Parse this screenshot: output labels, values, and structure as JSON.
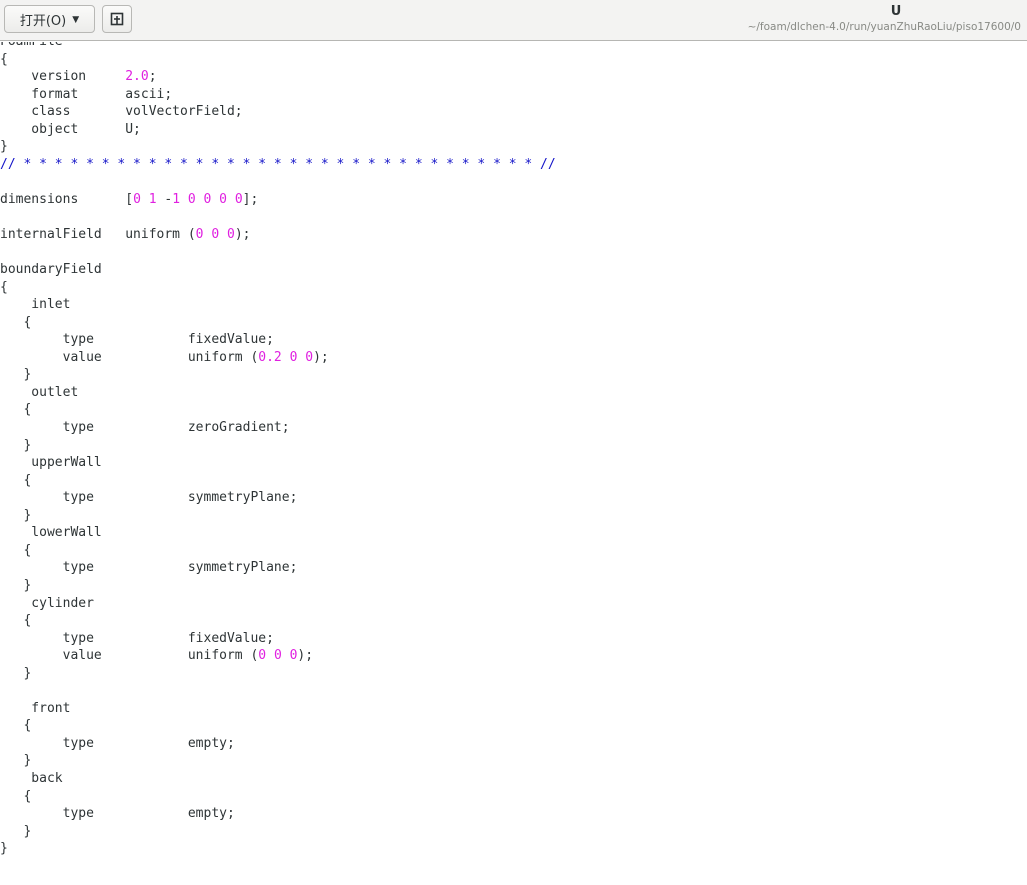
{
  "header": {
    "open_label": "打开(O)",
    "open_caret": "▼",
    "new_tab_icon": "new-tab-icon",
    "title": "U",
    "path": "~/foam/dlchen-4.0/run/yuanZhuRaoLiu/piso17600/0"
  },
  "editor": {
    "lines": [
      [
        {
          "t": "FoamFile"
        }
      ],
      [
        {
          "t": "{"
        }
      ],
      [
        {
          "t": "    version     "
        },
        {
          "t": "2.0",
          "c": "num"
        },
        {
          "t": ";"
        }
      ],
      [
        {
          "t": "    format      ascii;"
        }
      ],
      [
        {
          "t": "    class       volVectorField;"
        }
      ],
      [
        {
          "t": "    object      U;"
        }
      ],
      [
        {
          "t": "}"
        }
      ],
      [
        {
          "t": "// * * * * * * * * * * * * * * * * * * * * * * * * * * * * * * * * * //",
          "c": "comment"
        }
      ],
      [
        {
          "t": ""
        }
      ],
      [
        {
          "t": "dimensions      ["
        },
        {
          "t": "0",
          "c": "num"
        },
        {
          "t": " "
        },
        {
          "t": "1",
          "c": "num"
        },
        {
          "t": " -"
        },
        {
          "t": "1",
          "c": "num"
        },
        {
          "t": " "
        },
        {
          "t": "0",
          "c": "num"
        },
        {
          "t": " "
        },
        {
          "t": "0",
          "c": "num"
        },
        {
          "t": " "
        },
        {
          "t": "0",
          "c": "num"
        },
        {
          "t": " "
        },
        {
          "t": "0",
          "c": "num"
        },
        {
          "t": "];"
        }
      ],
      [
        {
          "t": ""
        }
      ],
      [
        {
          "t": "internalField   uniform ("
        },
        {
          "t": "0",
          "c": "num"
        },
        {
          "t": " "
        },
        {
          "t": "0",
          "c": "num"
        },
        {
          "t": " "
        },
        {
          "t": "0",
          "c": "num"
        },
        {
          "t": ");"
        }
      ],
      [
        {
          "t": ""
        }
      ],
      [
        {
          "t": "boundaryField"
        }
      ],
      [
        {
          "t": "{"
        }
      ],
      [
        {
          "t": "    inlet"
        }
      ],
      [
        {
          "t": "   {"
        }
      ],
      [
        {
          "t": "        type            fixedValue;"
        }
      ],
      [
        {
          "t": "        value           uniform ("
        },
        {
          "t": "0.2",
          "c": "num"
        },
        {
          "t": " "
        },
        {
          "t": "0",
          "c": "num"
        },
        {
          "t": " "
        },
        {
          "t": "0",
          "c": "num"
        },
        {
          "t": ");"
        }
      ],
      [
        {
          "t": "   }"
        }
      ],
      [
        {
          "t": "    outlet"
        }
      ],
      [
        {
          "t": "   {"
        }
      ],
      [
        {
          "t": "        type            zeroGradient;"
        }
      ],
      [
        {
          "t": "   }"
        }
      ],
      [
        {
          "t": "    upperWall"
        }
      ],
      [
        {
          "t": "   {"
        }
      ],
      [
        {
          "t": "        type            symmetryPlane;"
        }
      ],
      [
        {
          "t": "   }"
        }
      ],
      [
        {
          "t": "    lowerWall"
        }
      ],
      [
        {
          "t": "   {"
        }
      ],
      [
        {
          "t": "        type            symmetryPlane;"
        }
      ],
      [
        {
          "t": "   }"
        }
      ],
      [
        {
          "t": "    cylinder"
        }
      ],
      [
        {
          "t": "   {"
        }
      ],
      [
        {
          "t": "        type            fixedValue;"
        }
      ],
      [
        {
          "t": "        value           uniform ("
        },
        {
          "t": "0",
          "c": "num"
        },
        {
          "t": " "
        },
        {
          "t": "0",
          "c": "num"
        },
        {
          "t": " "
        },
        {
          "t": "0",
          "c": "num"
        },
        {
          "t": ");"
        }
      ],
      [
        {
          "t": "   }"
        }
      ],
      [
        {
          "t": ""
        }
      ],
      [
        {
          "t": "    front"
        }
      ],
      [
        {
          "t": "   {"
        }
      ],
      [
        {
          "t": "        type            empty;"
        }
      ],
      [
        {
          "t": "   }"
        }
      ],
      [
        {
          "t": "    back"
        }
      ],
      [
        {
          "t": "   {"
        }
      ],
      [
        {
          "t": "        type            empty;"
        }
      ],
      [
        {
          "t": "   }"
        }
      ],
      [
        {
          "t": "}"
        }
      ]
    ]
  }
}
